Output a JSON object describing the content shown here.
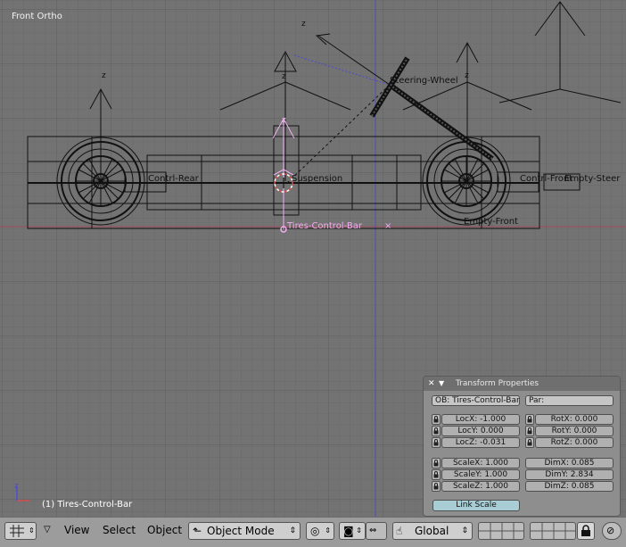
{
  "viewport": {
    "view_name": "Front Ortho",
    "status_object": "(1) Tires-Control-Bar",
    "axis_label": "z",
    "object_labels": {
      "steering_wheel": "Steering-Wheel",
      "suspension": "Suspension",
      "tires_control_bar": "Tires-Control-Bar",
      "rear_left": "Contrl-Rear",
      "front_right": "Contrl-Front",
      "steer_empty": "Empty-Steer",
      "empty_front": "Empty-Front"
    }
  },
  "transform_panel": {
    "title": "Transform Properties",
    "object_name": "OB: Tires-Control-Bar",
    "parent": "Par:",
    "loc": {
      "x": "LocX: -1.000",
      "y": "LocY: 0.000",
      "z": "LocZ: -0.031"
    },
    "rot": {
      "x": "RotX: 0.000",
      "y": "RotY: 0.000",
      "z": "RotZ: 0.000"
    },
    "scale": {
      "x": "ScaleX: 1.000",
      "y": "ScaleY: 1.000",
      "z": "ScaleZ: 1.000"
    },
    "dim": {
      "x": "DimX: 0.085",
      "y": "DimY: 2.834",
      "z": "DimZ: 0.085"
    },
    "link_scale": "Link Scale"
  },
  "header": {
    "menus": {
      "view": "View",
      "select": "Select",
      "object": "Object"
    },
    "mode": "Object Mode",
    "orientation": "Global"
  }
}
